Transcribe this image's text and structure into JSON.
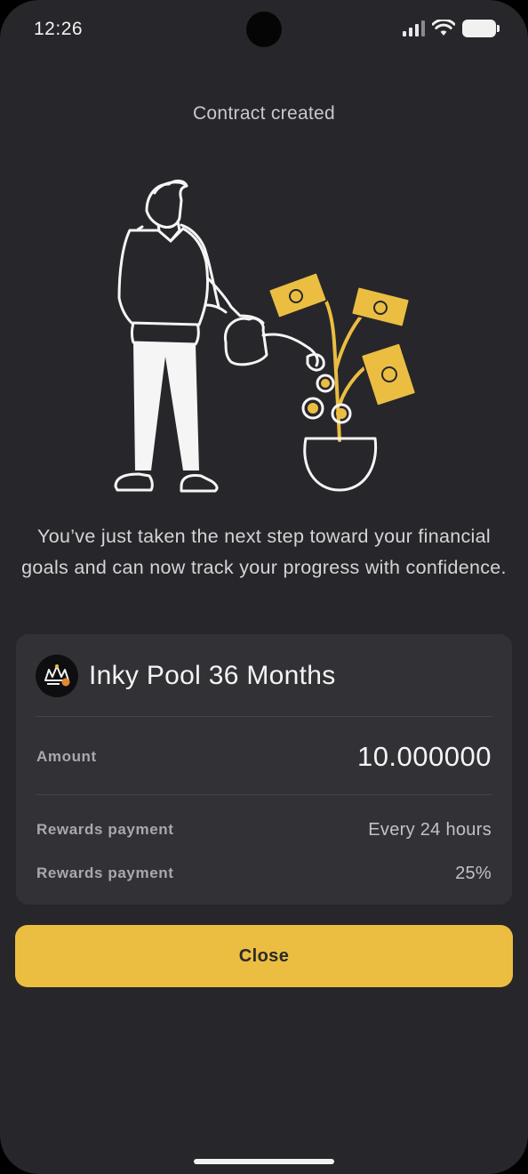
{
  "status_bar": {
    "time": "12:26",
    "icons": [
      "signal-icon",
      "wifi-icon",
      "battery-icon"
    ]
  },
  "page": {
    "title": "Contract created"
  },
  "illustration": {
    "description_icon": "watering-money-plant-illustration"
  },
  "message": "You’ve just taken the next step toward your financial goals and can now track your progress with confidence.",
  "contract": {
    "pool_name": "Inky Pool 36 Months",
    "amount_label": "Amount",
    "amount_value": "10.000000",
    "rows": [
      {
        "label": "Rewards payment",
        "value": "Every 24 hours"
      },
      {
        "label": "Rewards payment",
        "value": "25%"
      }
    ]
  },
  "actions": {
    "close_label": "Close"
  },
  "colors": {
    "background": "#27272b",
    "card": "#323236",
    "accent": "#ebbe42",
    "text": "#f4f4f5"
  }
}
